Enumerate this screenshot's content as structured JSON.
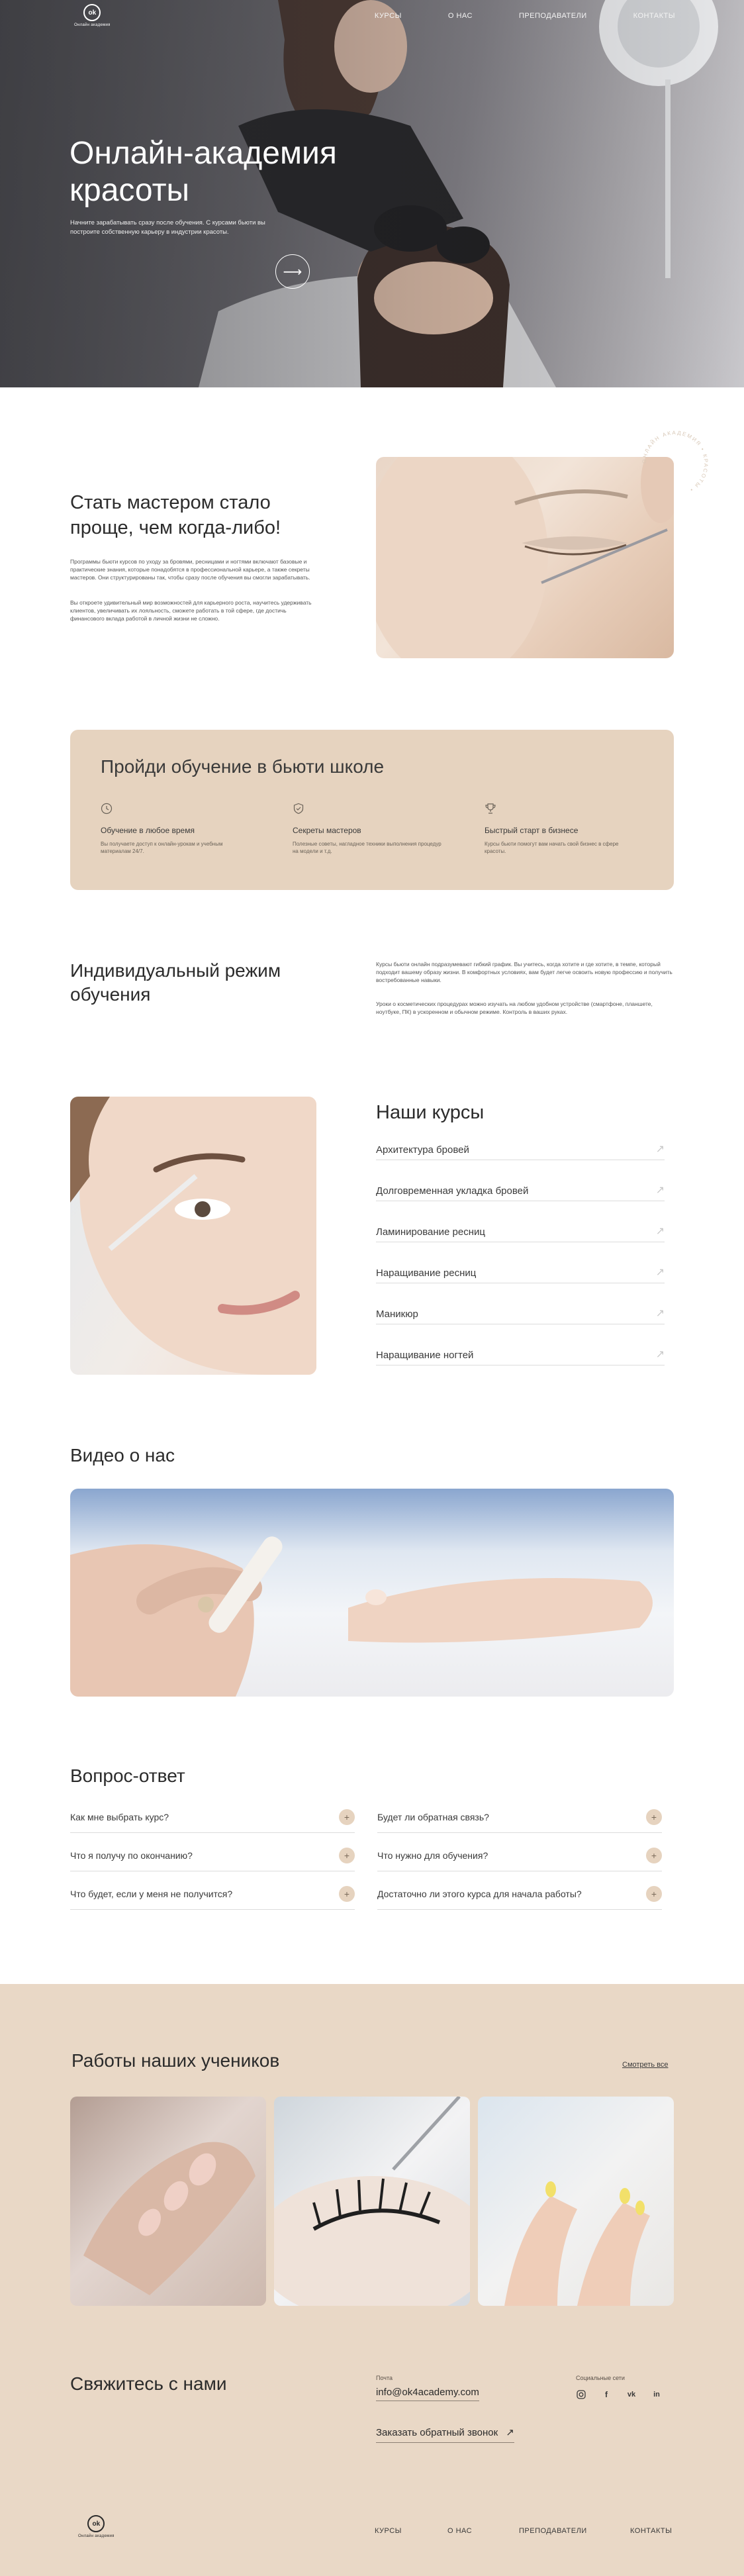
{
  "brand": {
    "logo_mark": "ok",
    "logo_caption": "Онлайн академия"
  },
  "nav": {
    "items": [
      "КУРСЫ",
      "О НАС",
      "ПРЕПОДАВАТЕЛИ",
      "КОНТАКТЫ"
    ]
  },
  "hero": {
    "title": "Онлайн-академия красоты",
    "lead": "Начните зарабатывать сразу после обучения. С курсами бьюти вы построите собственную карьеру в индустрии красоты.",
    "button_icon": "arrow-right-icon"
  },
  "intro": {
    "title": "Стать мастером стало проще, чем когда-либо!",
    "p1": "Программы бьюти курсов по уходу за бровями, ресницами и ногтями включают базовые и практические знания, которые понадобятся в профессиональной карьере, а также секреты мастеров. Они структурированы так, чтобы сразу после обучения вы смогли зарабатывать.",
    "p2": "Вы откроете удивительный мир возможностей для карьерного роста, научитесь удерживать клиентов, увеличивать их лояльность, сможете работать в той сфере, где достичь финансового вклада работой в личной жизни не сложно.",
    "stamp_text": "ОНЛАЙН АКАДЕМИЯ • КРАСОТЫ •"
  },
  "training": {
    "title": "Пройди обучение в бьюти школе",
    "features": [
      {
        "icon": "clock-icon",
        "title": "Обучение в любое время",
        "desc": "Вы получаете доступ к онлайн-урокам и учебным материалам 24/7."
      },
      {
        "icon": "shield-icon",
        "title": "Секреты мастеров",
        "desc": "Полезные советы, нагладное техники выполнения процедур на модели и т.д."
      },
      {
        "icon": "trophy-icon",
        "title": "Быстрый старт в бизнесе",
        "desc": "Курсы бьюти помогут вам начать свой бизнес в сфере красоты."
      }
    ]
  },
  "schedule": {
    "title": "Индивидуальный режим обучения",
    "p1": "Курсы бьюти онлайн подразумевают гибкий график. Вы учитесь, когда хотите и где хотите, в темпе, который подходит вашему образу жизни. В комфортных условиях, вам будет легче освоить новую профессию и получить востребованные навыки.",
    "p2": "Уроки о косметических процедурах можно изучать на любом удобном устройстве (смартфоне, планшете, ноутбуке, ПК) в ускоренном и обычном режиме. Контроль в ваших руках."
  },
  "courses": {
    "title": "Наши курсы",
    "items": [
      "Архитектура бровей",
      "Долговременная укладка бровей",
      "Ламинирование ресниц",
      "Наращивание ресниц",
      "Маникюр",
      "Наращивание ногтей"
    ]
  },
  "video": {
    "title": "Видео о нас"
  },
  "faq": {
    "title": "Вопрос-ответ",
    "left": [
      "Как мне выбрать курс?",
      "Что я получу по окончанию?",
      "Что будет, если у меня не получится?"
    ],
    "right": [
      "Будет ли обратная связь?",
      "Что нужно для обучения?",
      "Достаточно ли этого курса для начала работы?"
    ]
  },
  "works": {
    "title": "Работы наших учеников",
    "see_all": "Смотреть все"
  },
  "contact": {
    "title": "Свяжитесь с нами",
    "mail_label": "Почта",
    "email": "info@ok4academy.com",
    "callback": "Заказать обратный звонок",
    "social_label": "Социальные сети",
    "socials": [
      "instagram-icon",
      "facebook-icon",
      "vk-icon",
      "linkedin-icon"
    ]
  },
  "colors": {
    "beige": "#e6d3bf",
    "band": "#e9d8c6",
    "text": "#2b2b2b"
  }
}
